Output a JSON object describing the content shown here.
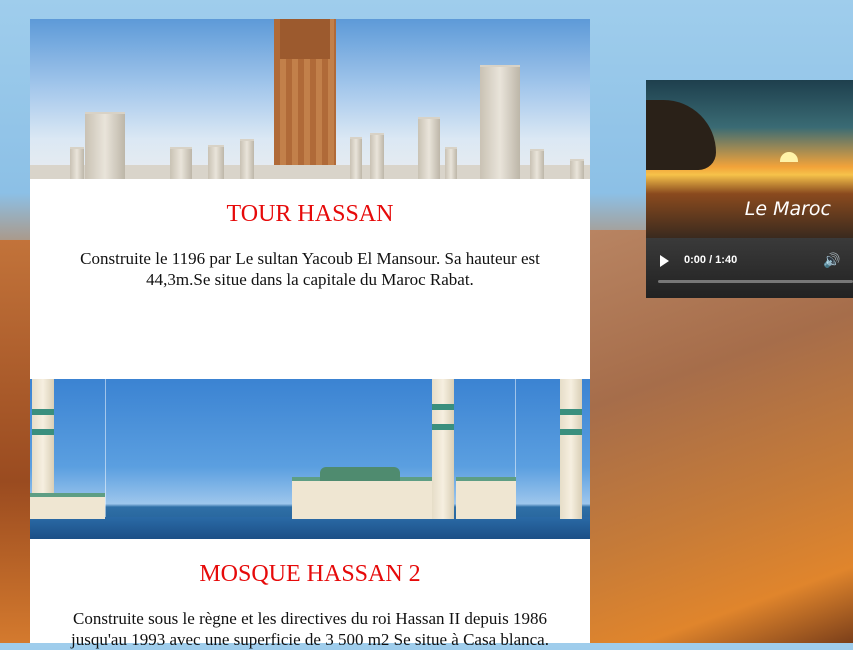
{
  "cards": [
    {
      "title": "TOUR HASSAN",
      "description": "Construite le 1196 par Le sultan Yacoub El Mansour. Sa hauteur est 44,3m.Se situe dans la capitale du Maroc Rabat."
    },
    {
      "title": "MOSQUE HASSAN 2",
      "description": "Construite sous le règne et les directives du roi Hassan II depuis 1986 jusqu'au 1993 avec une superficie de 3 500 m2 Se situe à Casa blanca."
    }
  ],
  "video": {
    "poster_text": "Le Maroc",
    "time": "0:00 / 1:40",
    "progress": 0
  },
  "colors": {
    "title": "#e60a0a",
    "card_bg": "#ffffff"
  }
}
